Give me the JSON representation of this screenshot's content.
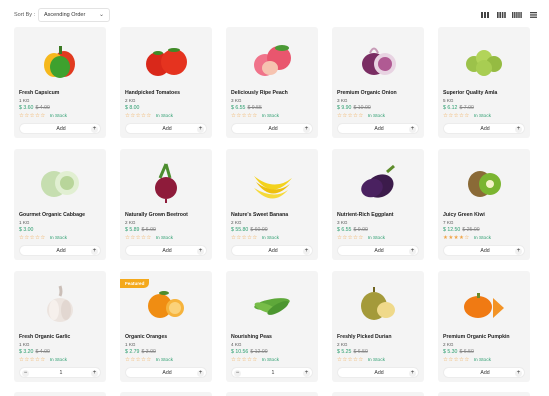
{
  "toolbar": {
    "sort_label": "Sort By :",
    "sort_value": "Ascending Order",
    "layout_buttons": [
      "grid-3-icon",
      "grid-4-icon",
      "grid-5-icon",
      "list-icon"
    ]
  },
  "products": [
    {
      "name": "Fresh Capsicum",
      "weight": "1 KG",
      "price": "$ 3.60",
      "old_price": "$ 4.99",
      "rating": 0,
      "stock": "In Stock",
      "action": "Add",
      "image": "capsicum"
    },
    {
      "name": "Handpicked Tomatoes",
      "weight": "2 KG",
      "price": "$ 8.00",
      "old_price": "",
      "rating": 0,
      "stock": "In Stock",
      "action": "Add",
      "image": "tomatoes"
    },
    {
      "name": "Deliciously Ripe Peach",
      "weight": "3 KG",
      "price": "$ 6.55",
      "old_price": "$ 9.55",
      "rating": 0,
      "stock": "In Stock",
      "action": "Add",
      "image": "peach"
    },
    {
      "name": "Premium Organic Onion",
      "weight": "3 KG",
      "price": "$ 9.90",
      "old_price": "$ 10.00",
      "rating": 0,
      "stock": "In Stock",
      "action": "Add",
      "image": "onion"
    },
    {
      "name": "Superior Quality Amla",
      "weight": "5 KG",
      "price": "$ 6.12",
      "old_price": "$ 7.00",
      "rating": 0,
      "stock": "In Stock",
      "action": "Add",
      "image": "amla"
    },
    {
      "name": "Gourmet Organic Cabbage",
      "weight": "1 KG",
      "price": "$ 3.00",
      "old_price": "",
      "rating": 0,
      "stock": "In Stock",
      "action": "Add",
      "image": "cabbage"
    },
    {
      "name": "Naturally Grown Beetroot",
      "weight": "2 KG",
      "price": "$ 5.89",
      "old_price": "$ 6.00",
      "rating": 0,
      "stock": "In Stock",
      "action": "Add",
      "image": "beetroot"
    },
    {
      "name": "Nature's Sweet Banana",
      "weight": "2 KG",
      "price": "$ 55.80",
      "old_price": "$ 60.00",
      "rating": 0,
      "stock": "In Stock",
      "action": "Add",
      "image": "banana"
    },
    {
      "name": "Nutrient-Rich Eggplant",
      "weight": "3 KG",
      "price": "$ 6.55",
      "old_price": "$ 9.00",
      "rating": 0,
      "stock": "In Stock",
      "action": "Add",
      "image": "eggplant"
    },
    {
      "name": "Juicy Green Kiwi",
      "weight": "7 KG",
      "price": "$ 12.50",
      "old_price": "$ 25.00",
      "rating": 4,
      "stock": "In Stock",
      "action": "Add",
      "image": "kiwi"
    },
    {
      "name": "Fresh Organic Garlic",
      "weight": "1 KG",
      "price": "$ 3.20",
      "old_price": "$ 4.00",
      "rating": 0,
      "stock": "In Stock",
      "action": "qty",
      "qty": "1",
      "image": "garlic"
    },
    {
      "name": "Organic Oranges",
      "weight": "1 KG",
      "price": "$ 2.79",
      "old_price": "$ 3.00",
      "rating": 0,
      "stock": "In Stock",
      "action": "Add",
      "badge": "Featured",
      "image": "orange"
    },
    {
      "name": "Nourishing Peas",
      "weight": "4 KG",
      "price": "$ 10.56",
      "old_price": "$ 12.00",
      "rating": 0,
      "stock": "In Stock",
      "action": "qty",
      "qty": "1",
      "image": "peas"
    },
    {
      "name": "Freshly Picked Durian",
      "weight": "2 KG",
      "price": "$ 5.25",
      "old_price": "$ 6.50",
      "rating": 0,
      "stock": "In Stock",
      "action": "Add",
      "image": "durian"
    },
    {
      "name": "Premium Organic Pumpkin",
      "weight": "2 KG",
      "price": "$ 5.30",
      "old_price": "$ 6.50",
      "rating": 0,
      "stock": "In Stock",
      "action": "Add",
      "image": "pumpkin"
    }
  ]
}
